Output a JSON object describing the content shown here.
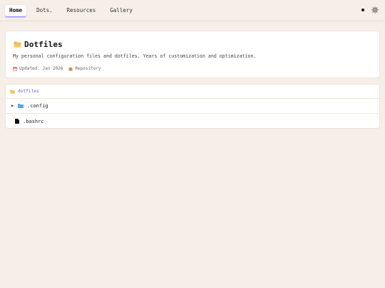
{
  "nav": {
    "tabs": [
      {
        "label": "Home",
        "active": true
      },
      {
        "label": "Dots."
      },
      {
        "label": "Resources"
      },
      {
        "label": "Gallery"
      }
    ],
    "icons": [
      "dot-icon",
      "sun-icon"
    ]
  },
  "header": {
    "title": "Dotfiles",
    "title_icon": "folder-icon",
    "description": "My personal configuration files and dotfiles. Years of customization and optimization.",
    "meta": {
      "updated": "Updated: Jan 2026",
      "repository": "Repository"
    }
  },
  "tree": {
    "path": "dotfiles",
    "items": [
      {
        "name": ".config",
        "type": "folder",
        "collapsed": true
      },
      {
        "name": ".bashrc",
        "type": "file"
      }
    ]
  },
  "colors": {
    "background": "#f5efe8",
    "accent": "#6b5fe8",
    "folder_blue": "#5aa8e0"
  }
}
